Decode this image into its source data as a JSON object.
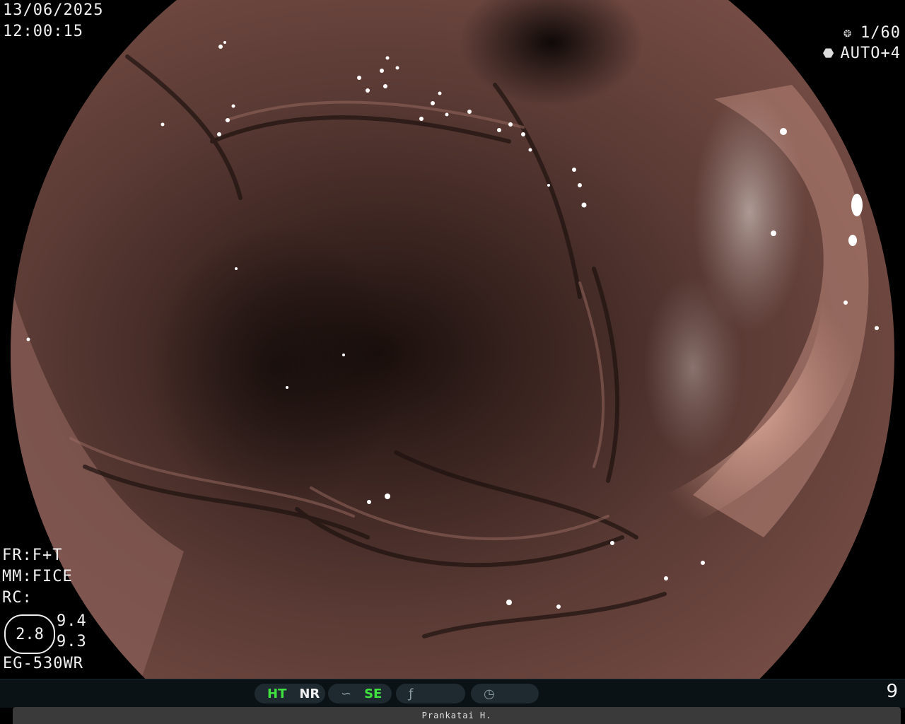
{
  "image": {
    "description": "endoscopic view of stomach mucosa (gastric folds)",
    "colors": {
      "mucosa": "#5a3a34",
      "highlight": "#c89484",
      "shadow": "#1a0f0c"
    }
  },
  "overlay": {
    "date": "13/06/2025",
    "time": "12:00:15",
    "shutter": "1/60",
    "shutter_icon": "shutter-icon",
    "iris": "AUTO+4",
    "iris_icon": "iris-icon",
    "fr": "FR:F+T",
    "mm": "MM:FICE",
    "rc": "RC:",
    "zoom": "2.8",
    "value1": "9.4",
    "value2": "9.3",
    "model": "EG-530WR"
  },
  "status_bar": {
    "ht": "HT",
    "nr": "NR",
    "se": "SE",
    "se_icon": "se-curve-icon",
    "f_icon": "f-icon",
    "wave_icon": "wave-circle-icon",
    "page": "9",
    "colors": {
      "active": "#3fe13f",
      "bar": "#0a1216",
      "pill": "#1f2a30"
    }
  },
  "footer": {
    "operator": "Prankatai H."
  }
}
